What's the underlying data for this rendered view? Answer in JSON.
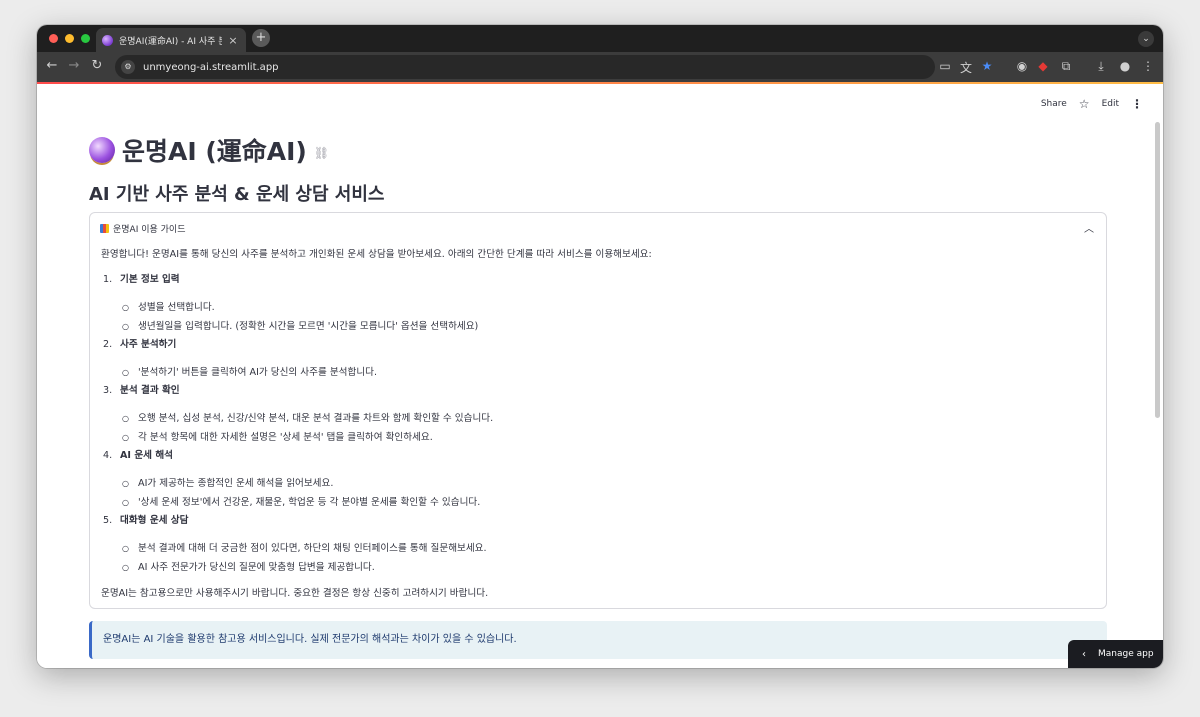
{
  "browser": {
    "tab_title": "운명AI(運命AI) - AI 사주 분석 & 운",
    "tab_close": "×",
    "new_tab": "+",
    "tab_dropdown": "⌄",
    "url": "unmyeong-ai.streamlit.app",
    "traffic_lights": [
      "#ff5f57",
      "#febc2e",
      "#28c840"
    ]
  },
  "streamlit_header": {
    "share_label": "Share",
    "edit_label": "Edit"
  },
  "main": {
    "title": "운명AI (運命AI)",
    "subtitle": "AI 기반 사주 분석 & 운세 상담 서비스",
    "guide": {
      "header": "운명AI 이용 가이드",
      "intro": "환영합니다! 운명AI를 통해 당신의 사주를 분석하고 개인화된 운세 상담을 받아보세요. 아래의 간단한 단계를 따라 서비스를 이용해보세요:",
      "steps": [
        {
          "num": "1.",
          "title": "기본 정보 입력",
          "bullets": [
            "성별을 선택합니다.",
            "생년월일을 입력합니다. (정확한 시간을 모르면 '시간을 모릅니다' 옵션을 선택하세요)"
          ]
        },
        {
          "num": "2.",
          "title": "사주 분석하기",
          "bullets": [
            "'분석하기' 버튼을 클릭하여 AI가 당신의 사주를 분석합니다."
          ]
        },
        {
          "num": "3.",
          "title": "분석 결과 확인",
          "bullets": [
            "오행 분석, 십성 분석, 신강/신약 분석, 대운 분석 결과를 차트와 함께 확인할 수 있습니다.",
            "각 분석 항목에 대한 자세한 설명은 '상세 분석' 탭을 클릭하여 확인하세요."
          ]
        },
        {
          "num": "4.",
          "title": "AI 운세 해석",
          "bullets": [
            "AI가 제공하는 종합적인 운세 해석을 읽어보세요.",
            "'상세 운세 정보'에서 건강운, 재물운, 학업운 등 각 분야별 운세를 확인할 수 있습니다."
          ]
        },
        {
          "num": "5.",
          "title": "대화형 운세 상담",
          "bullets": [
            "분석 결과에 대해 더 궁금한 점이 있다면, 하단의 채팅 인터페이스를 통해 질문해보세요.",
            "AI 사주 전문가가 당신의 질문에 맞춤형 답변을 제공합니다."
          ]
        }
      ],
      "outro": "운명AI는 참고용으로만 사용해주시기 바랍니다. 중요한 결정은 항상 신중히 고려하시기 바랍니다."
    },
    "info": "운명AI는 AI 기술을 활용한 참고용 서비스입니다. 실제 전문가의 해석과는 차이가 있을 수 있습니다."
  },
  "manage_app_label": "Manage app",
  "colors": {
    "accent_red": "#ff4b4b",
    "info_bg": "#e8f2f5",
    "info_border": "#3a69c7"
  }
}
